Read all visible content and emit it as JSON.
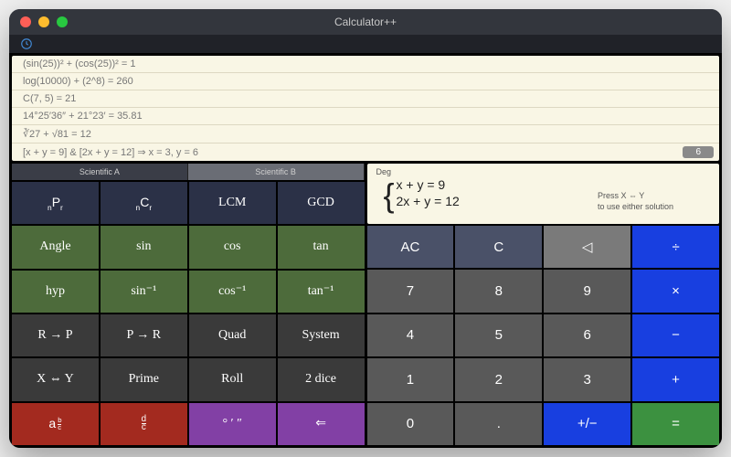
{
  "window": {
    "title": "Calculator++"
  },
  "history": {
    "rows": [
      "(sin(25))² + (cos(25))² = 1",
      "log(10000) + (2^8) = 260",
      "C(7, 5) = 21",
      "14°25′36″ + 21°23′ = 35.81",
      "∛27 + √81 = 12",
      "[x + y = 9]  &  [2x + y = 12] ⇒ x = 3, y = 6"
    ],
    "badge": "6"
  },
  "tabs": {
    "a": "Scientific A",
    "b": "Scientific B"
  },
  "sciB": {
    "nPr": "nPr",
    "nCr": "nCr",
    "lcm": "LCM",
    "gcd": "GCD",
    "angle": "Angle",
    "sin": "sin",
    "cos": "cos",
    "tan": "tan",
    "hyp": "hyp",
    "asin": "sin⁻¹",
    "acos": "cos⁻¹",
    "atan": "tan⁻¹",
    "r2p": "R → P",
    "p2r": "P → R",
    "quad": "Quad",
    "system": "System",
    "xswapy": "X ⇔ Y",
    "prime": "Prime",
    "roll": "Roll",
    "dice": "2 dice",
    "abc": "a b/c",
    "dc": "d/c",
    "dms": "° ′ ″",
    "back": "⇐"
  },
  "display": {
    "mode": "Deg",
    "eq1": "x + y = 9",
    "eq2": "2x + y = 12",
    "hint1": "Press X ⇔ Y",
    "hint2": "to use either solution"
  },
  "keypad": {
    "ac": "AC",
    "c": "C",
    "del": "◁",
    "div": "÷",
    "7": "7",
    "8": "8",
    "9": "9",
    "mul": "×",
    "4": "4",
    "5": "5",
    "6": "6",
    "sub": "−",
    "1": "1",
    "2": "2",
    "3": "3",
    "add": "+",
    "0": "0",
    "dot": ".",
    "pm": "+/−",
    "eq": "="
  }
}
